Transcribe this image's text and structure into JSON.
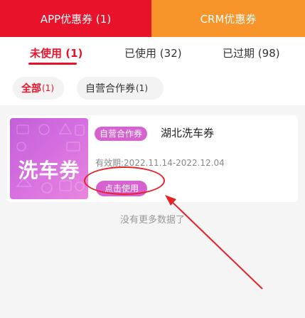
{
  "top_tabs": [
    {
      "label": "APP优惠券 (1)",
      "active": true
    },
    {
      "label": "CRM优惠券",
      "active": false
    }
  ],
  "status_tabs": [
    {
      "label": "未使用",
      "count": "(1)",
      "active": true
    },
    {
      "label": "已使用",
      "count": "(32)",
      "active": false
    },
    {
      "label": "已过期",
      "count": "(98)",
      "active": false
    }
  ],
  "filters": [
    {
      "label": "全部",
      "count": "(1)",
      "active": true
    },
    {
      "label": "自营合作券",
      "count": "(1)",
      "active": false
    }
  ],
  "coupon": {
    "thumb_text": "洗车券",
    "badge": "自营合作券",
    "name": "湖北洗车券",
    "validity": "有效期:2022.11.14-2022.12.04",
    "use_label": "点击使用"
  },
  "footer_text": "没有更多数据了",
  "colors": {
    "primary_red": "#e8132b",
    "crm_orange": "#f7942a",
    "coupon_purple": "#d662d0",
    "annotation_red": "#e42328"
  }
}
